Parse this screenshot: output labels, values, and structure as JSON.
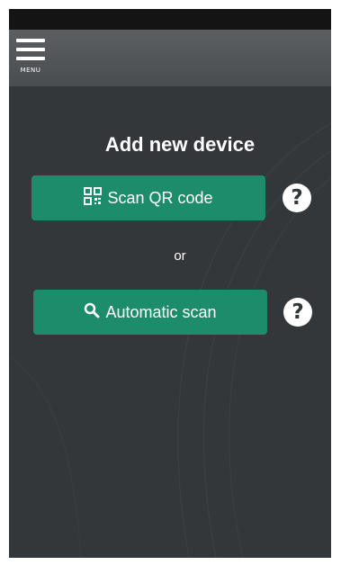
{
  "menu": {
    "label": "MENU"
  },
  "page": {
    "title": "Add new device"
  },
  "actions": {
    "scan_qr_label": "Scan QR code",
    "or_label": "or",
    "automatic_scan_label": "Automatic scan",
    "help_glyph": "?"
  },
  "icons": [
    "menu-icon",
    "qr-code-icon",
    "search-icon",
    "help-icon"
  ],
  "colors": {
    "background": "#33373a",
    "statusbar": "#141414",
    "appbar": "#545759",
    "accent": "#1d8c6a",
    "text": "#ffffff"
  }
}
